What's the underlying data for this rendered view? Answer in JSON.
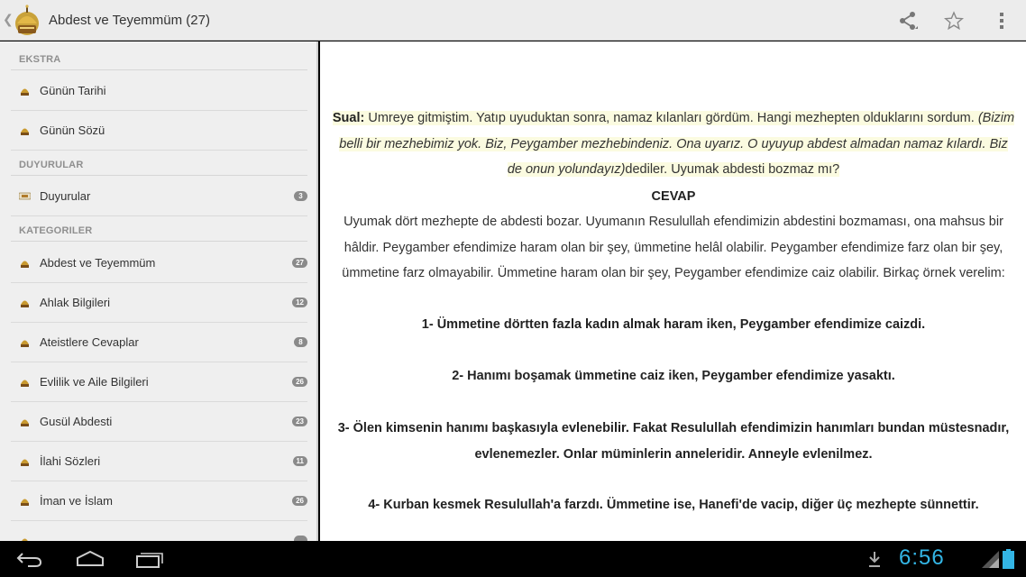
{
  "actionbar": {
    "title": "Abdest ve Teyemmüm (27)",
    "actions": [
      "share-icon",
      "star-icon",
      "overflow-menu-icon"
    ]
  },
  "drawer": {
    "sections": {
      "ekstra": "EKSTRA",
      "duyurular": "DUYURULAR",
      "kategoriler": "KATEGORILER"
    },
    "ekstra_items": [
      {
        "label": "Günün Tarihi"
      },
      {
        "label": "Günün Sözü"
      }
    ],
    "duyurular_items": [
      {
        "label": "Duyurular",
        "count": "3"
      }
    ],
    "kategori_items": [
      {
        "label": "Abdest ve Teyemmüm",
        "count": "27"
      },
      {
        "label": "Ahlak Bilgileri",
        "count": "12"
      },
      {
        "label": "Ateistlere Cevaplar",
        "count": "8"
      },
      {
        "label": "Evlilik ve Aile Bilgileri",
        "count": "26"
      },
      {
        "label": "Gusül Abdesti",
        "count": "23"
      },
      {
        "label": "İlahi Sözleri",
        "count": "11"
      },
      {
        "label": "İman ve İslam",
        "count": "26"
      }
    ]
  },
  "content": {
    "sual_label": "Sual:",
    "sual_part1": " Umreye gitmiştim. Yatıp uyuduktan sonra, namaz kılanları gördüm. Hangi mezhepten olduklarını sordum. ",
    "sual_italic": "(Bizim belli bir mezhebimiz yok. Biz, Peygamber mezhebindeniz. Ona uyarız. O uyuyup abdest almadan namaz kılardı. Biz de onun yolundayız)",
    "sual_part2": "dediler. Uyumak abdesti bozmaz mı?",
    "cevap_label": "CEVAP",
    "cevap_text": "Uyumak dört mezhepte de abdesti bozar. Uyumanın Resulullah efendimizin abdestini bozmaması, ona mahsus bir hâldir. Peygamber efendimize haram olan bir şey, ümmetine helâl olabilir. Peygamber efendimize farz olan bir şey, ümmetine farz olmayabilir. Ümmetine haram olan bir şey, Peygamber efendimize caiz olabilir. Birkaç örnek verelim:",
    "point1": "1- Ümmetine dörtten fazla kadın almak haram iken, Peygamber efendimize caizdi.",
    "point2": "2- Hanımı boşamak ümmetine caiz iken, Peygamber efendimize yasaktı.",
    "point3": "3- Ölen kimsenin hanımı başkasıyla evlenebilir. Fakat Resulullah efendimizin hanımları bundan müstesnadır, evlenemezler. Onlar müminlerin anneleridir. Anneyle evlenilmez.",
    "point4": "4- Kurban kesmek Resulullah'a farzdı. Ümmetine ise, Hanefi'de vacip, diğer üç mezhepte sünnettir."
  },
  "systembar": {
    "clock": "6:56",
    "accent": "#33b5e5"
  }
}
